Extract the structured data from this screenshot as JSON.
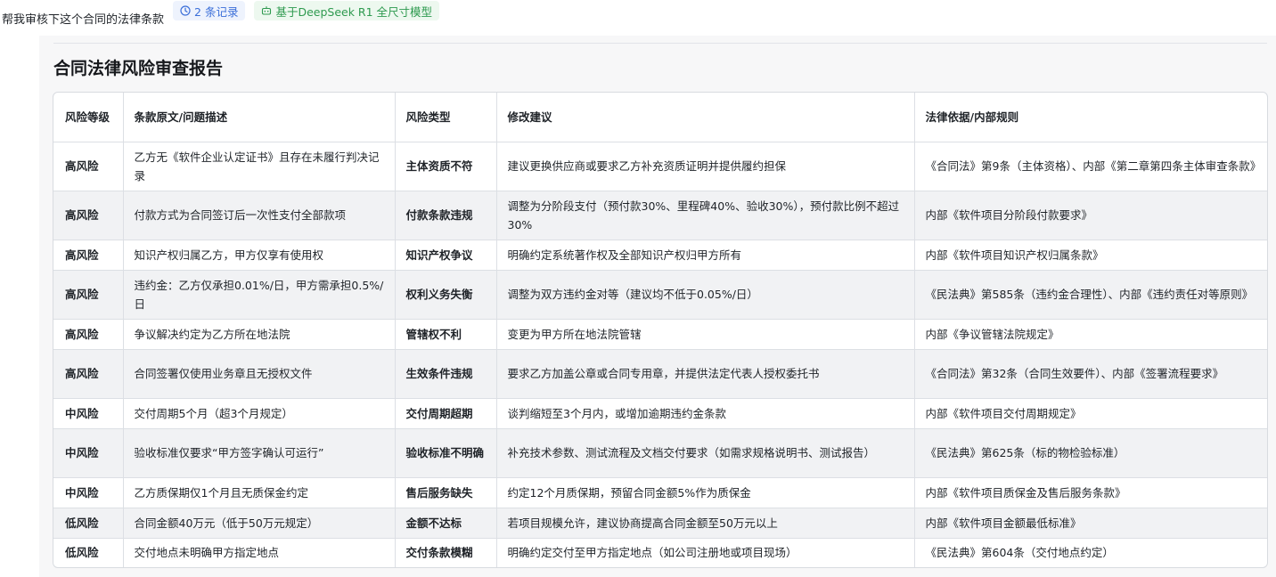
{
  "query": {
    "text": "帮我审核下这个合同的法律条款",
    "records_chip": "2 条记录",
    "records_icon": "clock-icon",
    "model_chip": "基于DeepSeek R1 全尺寸模型",
    "model_icon": "robot-icon"
  },
  "colors": {
    "records_chip_bg": "#eef3fd",
    "records_chip_text": "#3b6fd9",
    "model_chip_bg": "#edf8ef",
    "model_chip_text": "#2e9a4f"
  },
  "report": {
    "title": "合同法律风险审查报告",
    "headers": [
      "风险等级",
      "条款原文/问题描述",
      "风险类型",
      "修改建议",
      "法律依据/内部规则"
    ],
    "rows": [
      [
        "高风险",
        "乙方无《软件企业认定证书》且存在未履行判决记录",
        "主体资质不符",
        "建议更换供应商或要求乙方补充资质证明并提供履约担保",
        "《合同法》第9条（主体资格）、内部《第二章第四条主体审查条款》"
      ],
      [
        "高风险",
        "付款方式为合同签订后一次性支付全部款项",
        "付款条款违规",
        "调整为分阶段支付（预付款30%、里程碑40%、验收30%），预付款比例不超过30%",
        "内部《软件项目分阶段付款要求》"
      ],
      [
        "高风险",
        "知识产权归属乙方，甲方仅享有使用权",
        "知识产权争议",
        "明确约定系统著作权及全部知识产权归甲方所有",
        "内部《软件项目知识产权归属条款》"
      ],
      [
        "高风险",
        "违约金：乙方仅承担0.01%/日，甲方需承担0.5%/日",
        "权利义务失衡",
        "调整为双方违约金对等（建议均不低于0.05%/日）",
        "《民法典》第585条（违约金合理性）、内部《违约责任对等原则》"
      ],
      [
        "高风险",
        "争议解决约定为乙方所在地法院",
        "管辖权不利",
        "变更为甲方所在地法院管辖",
        "内部《争议管辖法院规定》"
      ],
      [
        "高风险",
        "合同签署仅使用业务章且无授权文件",
        "生效条件违规",
        "要求乙方加盖公章或合同专用章，并提供法定代表人授权委托书",
        "《合同法》第32条（合同生效要件）、内部《签署流程要求》"
      ],
      [
        "中风险",
        "交付周期5个月（超3个月规定）",
        "交付周期超期",
        "谈判缩短至3个月内，或增加逾期违约金条款",
        "内部《软件项目交付周期规定》"
      ],
      [
        "中风险",
        "验收标准仅要求“甲方签字确认可运行”",
        "验收标准不明确",
        "补充技术参数、测试流程及文档交付要求（如需求规格说明书、测试报告）",
        "《民法典》第625条（标的物检验标准）"
      ],
      [
        "中风险",
        "乙方质保期仅1个月且无质保金约定",
        "售后服务缺失",
        "约定12个月质保期，预留合同金额5%作为质保金",
        "内部《软件项目质保金及售后服务条款》"
      ],
      [
        "低风险",
        "合同金额40万元（低于50万元规定）",
        "金额不达标",
        "若项目规模允许，建议协商提高合同金额至50万元以上",
        "内部《软件项目金额最低标准》"
      ],
      [
        "低风险",
        "交付地点未明确甲方指定地点",
        "交付条款模糊",
        "明确约定交付至甲方指定地点（如公司注册地或项目现场）",
        "《民法典》第604条（交付地点约定）"
      ]
    ]
  }
}
